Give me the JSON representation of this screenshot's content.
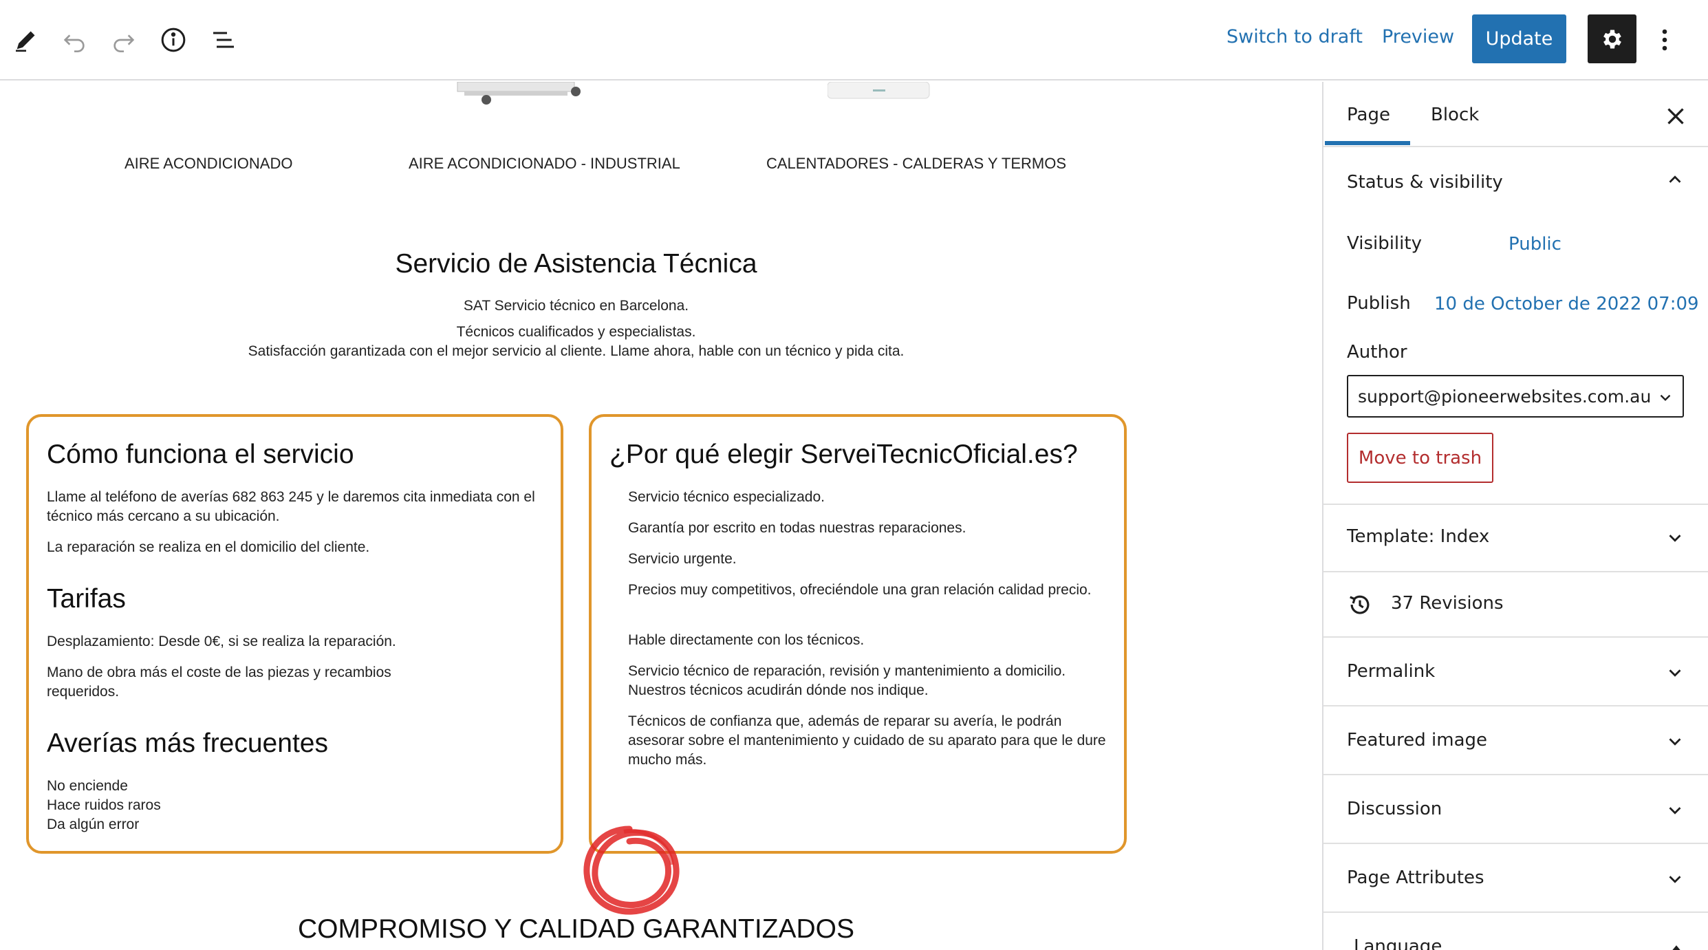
{
  "toolbar": {
    "icons": [
      "pen-icon",
      "undo-icon",
      "redo-icon",
      "info-icon",
      "list-view-icon"
    ],
    "switch_to_draft": "Switch to draft",
    "preview": "Preview",
    "update": "Update",
    "settings_icon": "gear-icon",
    "more_icon": "vertical-dots-icon"
  },
  "content": {
    "categories": [
      "AIRE ACONDICIONADO",
      "AIRE ACONDICIONADO - INDUSTRIAL",
      "CALENTADORES - CALDERAS Y TERMOS"
    ],
    "sat_title": "Servicio de Asistencia Técnica",
    "sat_lines": [
      "SAT Servicio técnico en Barcelona.",
      "Técnicos cualificados y especialistas.",
      "Satisfacción garantizada con el mejor servicio al cliente. Llame ahora, hable con un técnico y pida cita."
    ],
    "card_left": {
      "heading1": "Cómo funciona el servicio",
      "p1": "Llame al teléfono de averías 682 863 245 y le daremos cita inmediata con el técnico más cercano a su ubicación.",
      "p2": "La reparación se realiza en el domicilio del cliente.",
      "heading2": "Tarifas",
      "p3": "Desplazamiento: Desde 0€, si se realiza la reparación.",
      "p4": "Mano de obra más el coste de las piezas y recambios requeridos.",
      "heading3": "Averías más frecuentes",
      "faults": [
        "No enciende",
        "Hace ruidos raros",
        "Da algún error"
      ]
    },
    "card_right": {
      "heading": "¿Por qué elegir ServeiTecnicOficial.es?",
      "items": [
        "Servicio técnico especializado.",
        "Garantía por escrito en todas nuestras reparaciones.",
        "Servicio urgente.",
        "Precios muy competitivos, ofreciéndole una gran relación calidad precio.",
        "Hable directamente con los técnicos.",
        "Servicio técnico de reparación, revisión y mantenimiento a domicilio. Nuestros técnicos acudirán dónde nos indique.",
        "Técnicos de confianza que, además de reparar su avería, le podrán asesorar sobre el mantenimiento y cuidado de su aparato para que le dure mucho más."
      ]
    },
    "compromiso": "COMPROMISO Y CALIDAD GARANTIZADOS",
    "annotation_color": "#e02424"
  },
  "sidebar": {
    "tabs": [
      "Page",
      "Block"
    ],
    "active_tab": "Page",
    "status_visibility": {
      "title": "Status & visibility",
      "visibility_label": "Visibility",
      "visibility_value": "Public",
      "publish_label": "Publish",
      "publish_value": "10 de October de 2022 07:09",
      "author_label": "Author",
      "author_value": "support@pioneerwebsites.com.au",
      "trash_label": "Move to trash"
    },
    "template": "Template: Index",
    "revisions": "37 Revisions",
    "panels": [
      "Permalink",
      "Featured image",
      "Discussion",
      "Page Attributes",
      "Language"
    ]
  },
  "colors": {
    "accent": "#2271b1",
    "card_border": "#e0962b",
    "danger": "#b32d2e",
    "dark": "#1e1e1e"
  }
}
